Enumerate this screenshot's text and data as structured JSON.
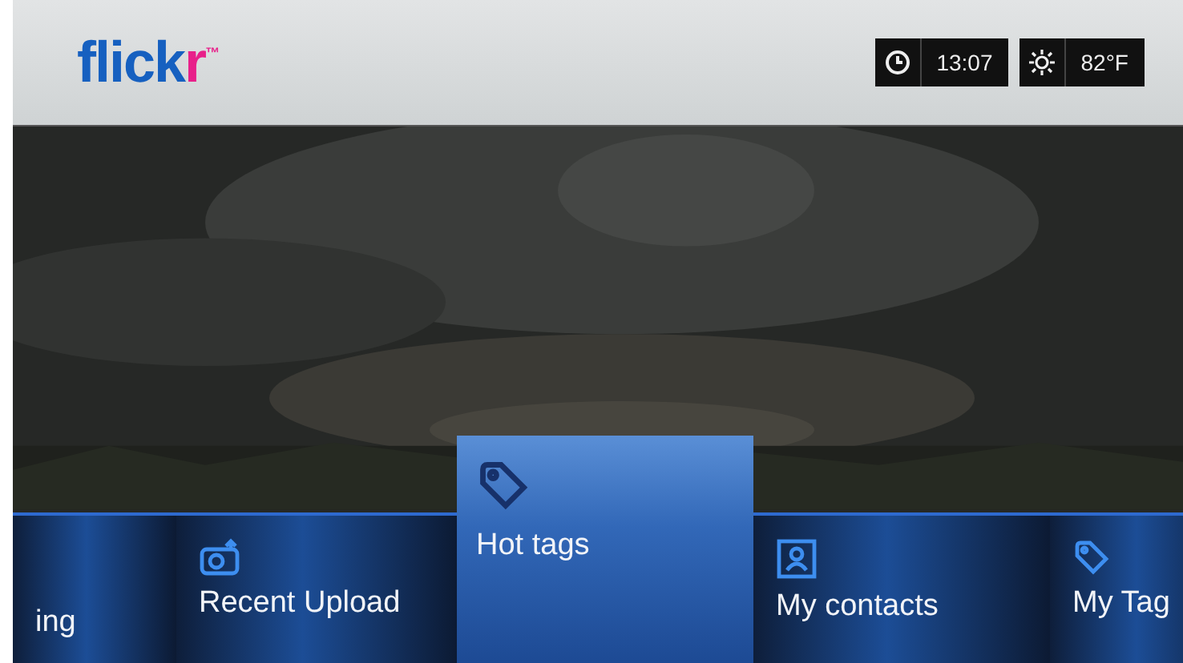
{
  "header": {
    "logo_main": "flick",
    "logo_accent": "r",
    "logo_mark": "™",
    "clock": "13:07",
    "weather": "82°F"
  },
  "menu": [
    {
      "label": "ing",
      "selected": false
    },
    {
      "label": "Recent Upload",
      "selected": false
    },
    {
      "label": "Hot tags",
      "selected": true
    },
    {
      "label": "My contacts",
      "selected": false
    },
    {
      "label": "My Tag",
      "selected": false
    }
  ]
}
